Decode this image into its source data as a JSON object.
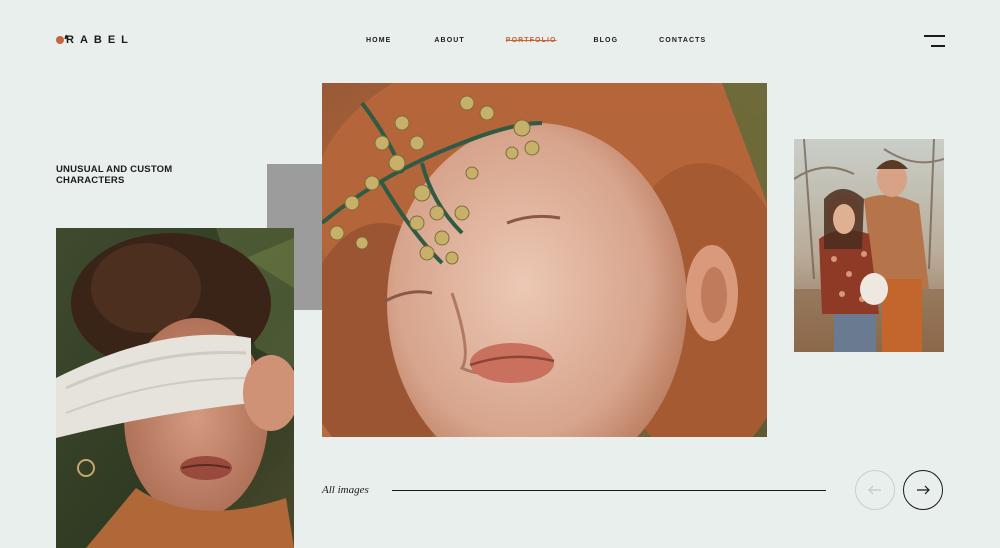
{
  "brand": {
    "name": "RABEL",
    "accent_color": "#c8643c"
  },
  "nav": {
    "items": [
      {
        "label": "HOME",
        "active": false
      },
      {
        "label": "ABOUT",
        "active": false
      },
      {
        "label": "PORTFOLIO",
        "active": true
      },
      {
        "label": "BLOG",
        "active": false
      },
      {
        "label": "CONTACTS",
        "active": false
      }
    ],
    "menu_icon": "hamburger-menu-icon"
  },
  "hero": {
    "tagline": "UNUSUAL AND CUSTOM CHARACTERS"
  },
  "gallery": {
    "photos": [
      {
        "name": "photo-blindfolded-woman"
      },
      {
        "name": "photo-redhead-with-berries"
      },
      {
        "name": "photo-couple-outdoors"
      }
    ],
    "all_images_label": "All images",
    "prev_icon": "arrow-left-icon",
    "next_icon": "arrow-right-icon"
  }
}
